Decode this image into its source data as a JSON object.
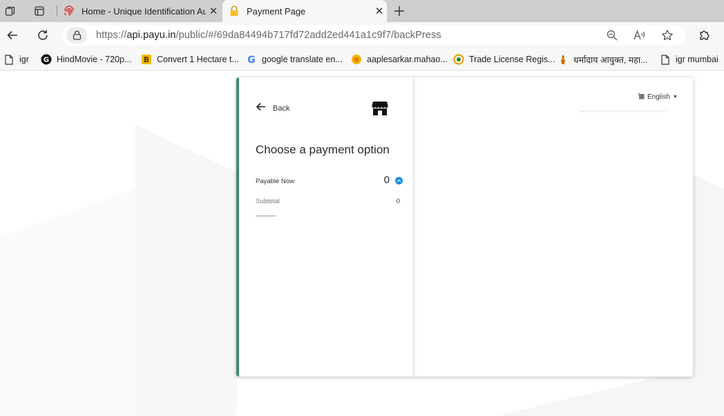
{
  "browser": {
    "tabs": [
      {
        "title": "Home - Unique Identification Au",
        "active": false
      },
      {
        "title": "Payment Page",
        "active": true
      }
    ],
    "address_bar": {
      "scheme": "https://",
      "host": "api.payu.in",
      "path": "/public/#/69da84494b717fd72add2ed441a1c9f7/backPress"
    },
    "bookmarks": [
      {
        "label": "igr",
        "icon": "page-icon"
      },
      {
        "label": "HindMovie - 720p...",
        "icon": "g-logo-icon"
      },
      {
        "label": "Convert 1 Hectare t...",
        "icon": "b-logo-icon"
      },
      {
        "label": "google translate en...",
        "icon": "google-icon"
      },
      {
        "label": "aaplesarkar.mahao...",
        "icon": "coin-icon"
      },
      {
        "label": "Trade License Regis...",
        "icon": "chrome-ring-icon"
      },
      {
        "label": "धर्मादाय आयुक्त, महा...",
        "icon": "emblem-icon"
      },
      {
        "label": "igr mumbai",
        "icon": "page-icon"
      }
    ]
  },
  "payment": {
    "back_label": "Back",
    "title": "Choose a payment option",
    "payable_label": "Payable Now",
    "payable_value": "0",
    "subtotal_label": "Subtotal",
    "subtotal_value": "0",
    "language": "English"
  },
  "colors": {
    "accent_border": "#3d8a71",
    "info_blue": "#1a8cec"
  }
}
